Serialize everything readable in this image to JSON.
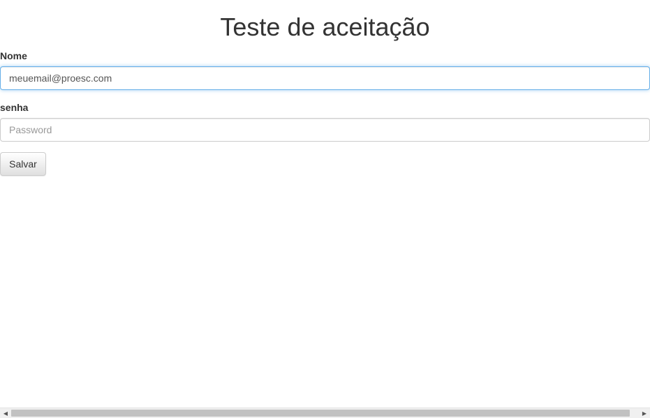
{
  "page": {
    "title": "Teste de aceitação"
  },
  "form": {
    "nome": {
      "label": "Nome",
      "value": "meuemail@proesc.com",
      "placeholder": ""
    },
    "senha": {
      "label": "senha",
      "value": "",
      "placeholder": "Password"
    },
    "submit_label": "Salvar"
  },
  "scrollbar": {
    "left_icon": "triangle-left-icon",
    "right_icon": "triangle-right-icon"
  },
  "colors": {
    "focus_border": "#66afe9",
    "text": "#333333",
    "input_border": "#cccccc"
  }
}
